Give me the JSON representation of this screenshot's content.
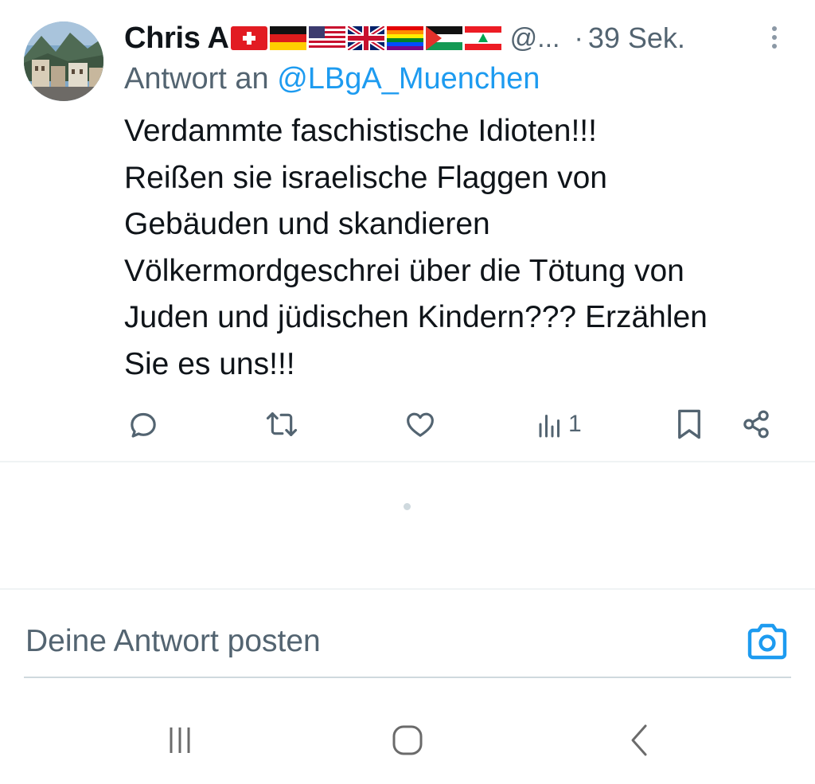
{
  "tweet": {
    "author_name": "Chris A",
    "flags": [
      "swiss-flag-icon",
      "german-flag-icon",
      "us-flag-icon",
      "uk-flag-icon",
      "rainbow-flag-icon",
      "palestine-flag-icon",
      "lebanon-flag-icon"
    ],
    "handle": "@...",
    "separator": "·",
    "time": "39 Sek.",
    "reply_prefix": "Antwort an",
    "reply_to": "@LBgA_Muenchen",
    "text_lines": [
      "Verdammte faschistische Idioten!!!",
      "Reißen sie israelische Flaggen von",
      "Gebäuden und skandieren",
      "Völkermordgeschrei über die Tötung von",
      "Juden und jüdischen Kindern??? Erzählen",
      "Sie es uns!!!"
    ],
    "views_count": "1"
  },
  "reply_bar": {
    "placeholder": "Deine Antwort posten"
  },
  "colors": {
    "accent": "#1d9bf0",
    "text": "#0f1419",
    "secondary": "#536471",
    "divider": "#eff3f4"
  },
  "icons": [
    "reply-icon",
    "retweet-icon",
    "like-icon",
    "views-icon",
    "bookmark-icon",
    "share-icon",
    "camera-icon",
    "recent-apps-icon",
    "home-icon",
    "back-icon",
    "more-options-icon"
  ]
}
